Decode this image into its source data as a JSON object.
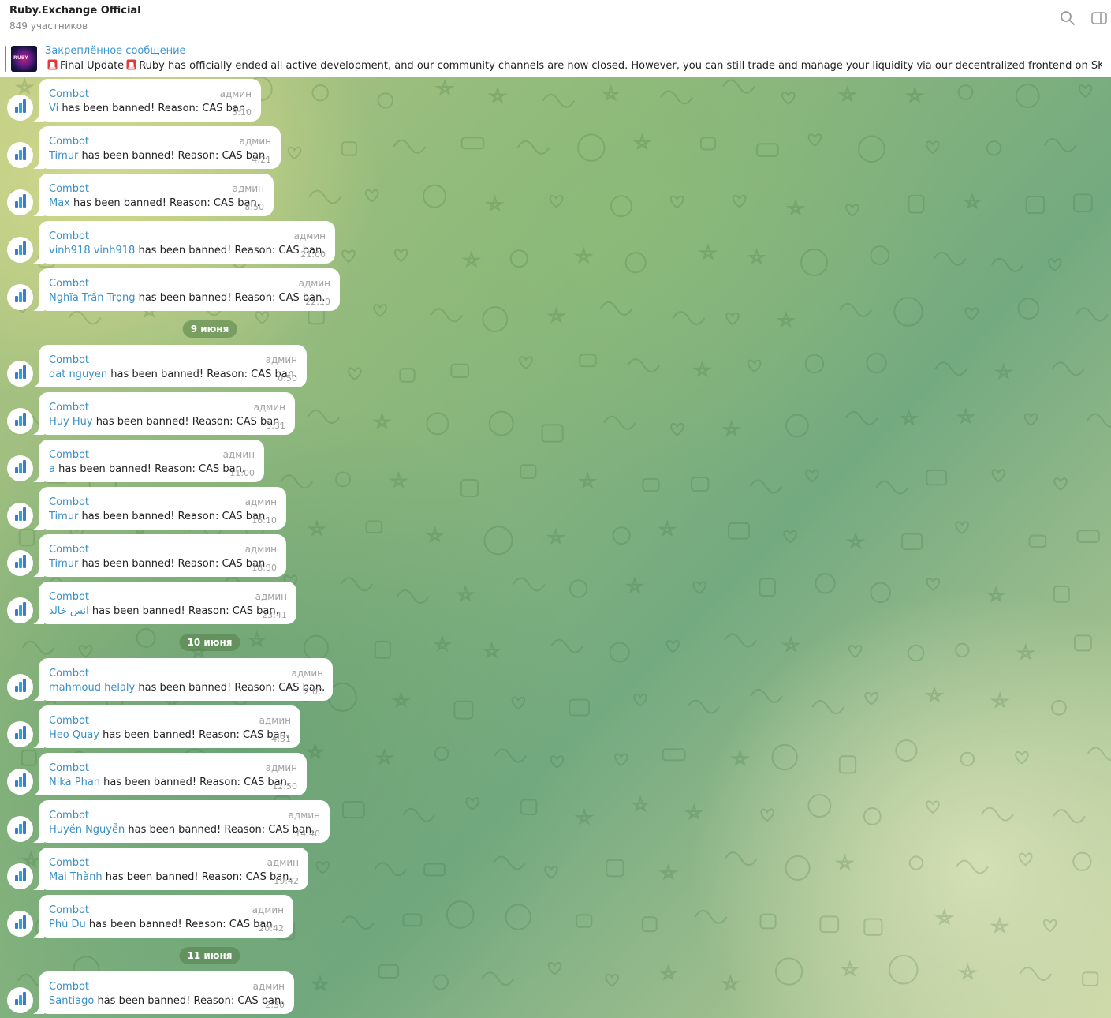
{
  "header": {
    "title": "Ruby.Exchange Official",
    "subtitle": "849 участников",
    "search_icon": "search-icon",
    "panel_icon": "sidebar-toggle-icon"
  },
  "pinned": {
    "label": "Закреплённое сообщение",
    "thumb_text": "RUBY",
    "text_part1": "Final Update",
    "text_part2": "Ruby has officially ended all active development, and our community channels are now closed.  However, you can still trade and manage your liquidity via our decentralized frontend on SKALE:  mainnet...."
  },
  "colors": {
    "accent": "#3a95d5",
    "link": "#3a8fc4",
    "avatar_bar_1": "#3a7bd5",
    "avatar_bar_2": "#2aa6d9",
    "avatar_bar_3": "#3a7bd5"
  },
  "messages": [
    {
      "sender": "Combot",
      "role": "админ",
      "user": "Vi",
      "text": " has been banned! Reason: CAS ban.",
      "time": "3:10"
    },
    {
      "sender": "Combot",
      "role": "админ",
      "user": "Timur",
      "text": " has been banned! Reason: CAS ban.",
      "time": "4:21"
    },
    {
      "sender": "Combot",
      "role": "админ",
      "user": "Max",
      "text": " has been banned! Reason: CAS ban.",
      "time": "8:50"
    },
    {
      "sender": "Combot",
      "role": "админ",
      "user": "vinh918 vinh918",
      "text": " has been banned! Reason: CAS ban.",
      "time": "21:00"
    },
    {
      "sender": "Combot",
      "role": "админ",
      "user": "Nghĩa Trần Trọng",
      "text": " has been banned! Reason: CAS ban.",
      "time": "22:10"
    },
    {
      "sender": "Combot",
      "role": "админ",
      "user": "dat nguyen",
      "text": " has been banned! Reason: CAS ban.",
      "time": "0:50"
    },
    {
      "sender": "Combot",
      "role": "админ",
      "user": "Huy Huy",
      "text": " has been banned! Reason: CAS ban.",
      "time": "3:31"
    },
    {
      "sender": "Combot",
      "role": "админ",
      "user": "a",
      "text": " has been banned! Reason: CAS ban.",
      "time": "11:00"
    },
    {
      "sender": "Combot",
      "role": "админ",
      "user": "Timur",
      "text": " has been banned! Reason: CAS ban.",
      "time": "16:10"
    },
    {
      "sender": "Combot",
      "role": "админ",
      "user": "Timur",
      "text": " has been banned! Reason: CAS ban.",
      "time": "18:30"
    },
    {
      "sender": "Combot",
      "role": "админ",
      "user": "انس خالد",
      "text": " has been banned! Reason: CAS ban.",
      "time": "23:41"
    },
    {
      "sender": "Combot",
      "role": "админ",
      "user": "mahmoud helaly",
      "text": " has been banned! Reason: CAS ban.",
      "time": "2:00"
    },
    {
      "sender": "Combot",
      "role": "админ",
      "user": "Heo Quay",
      "text": " has been banned! Reason: CAS ban.",
      "time": "4:31"
    },
    {
      "sender": "Combot",
      "role": "админ",
      "user": "Nika Phan",
      "text": " has been banned! Reason: CAS ban.",
      "time": "12:50"
    },
    {
      "sender": "Combot",
      "role": "админ",
      "user": "Huyền Nguyễn",
      "text": " has been banned! Reason: CAS ban.",
      "time": "14:40"
    },
    {
      "sender": "Combot",
      "role": "админ",
      "user": "Mai Thành",
      "text": " has been banned! Reason: CAS ban.",
      "time": "19:42"
    },
    {
      "sender": "Combot",
      "role": "админ",
      "user": "Phù Du",
      "text": " has been banned! Reason: CAS ban.",
      "time": "20:42"
    },
    {
      "sender": "Combot",
      "role": "админ",
      "user": "Santiago",
      "text": " has been banned! Reason: CAS ban.",
      "time": "2:30"
    }
  ],
  "date_separators": [
    "9 июня",
    "10 июня",
    "11 июня"
  ]
}
